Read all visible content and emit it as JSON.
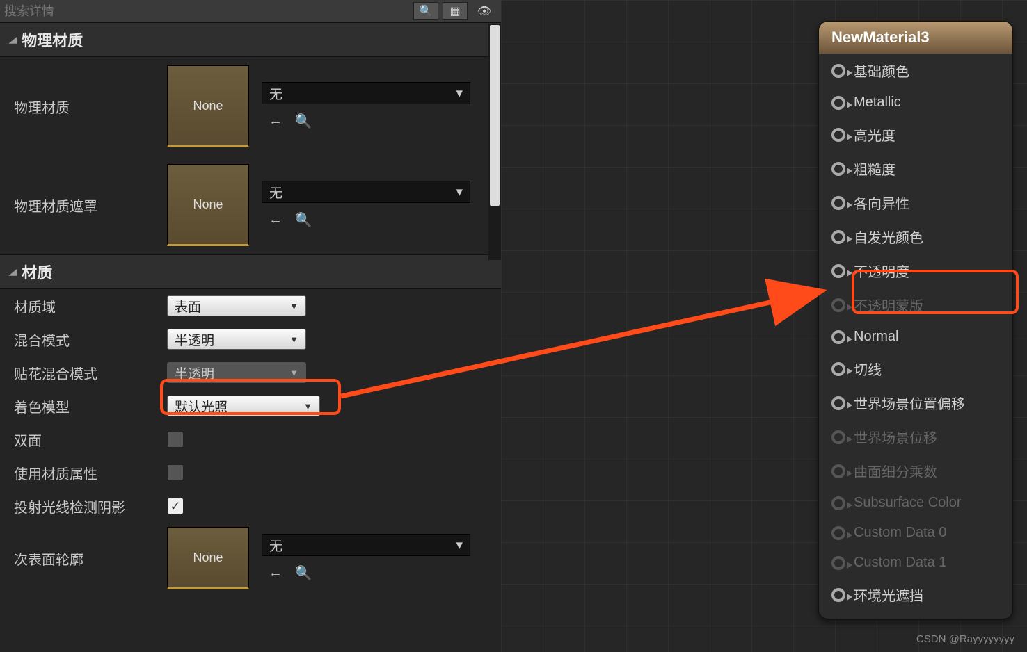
{
  "search": {
    "placeholder": "搜索详情"
  },
  "sections": {
    "physMat": "物理材质",
    "material": "材质"
  },
  "props": {
    "physMat": {
      "label": "物理材质",
      "thumb": "None",
      "dd": "无"
    },
    "physMatMask": {
      "label": "物理材质遮罩",
      "thumb": "None",
      "dd": "无"
    },
    "domain": {
      "label": "材质域",
      "value": "表面"
    },
    "blend": {
      "label": "混合模式",
      "value": "半透明"
    },
    "decalBlend": {
      "label": "贴花混合模式",
      "value": "半透明"
    },
    "shading": {
      "label": "着色模型",
      "value": "默认光照"
    },
    "twoSided": {
      "label": "双面"
    },
    "useMatAttrs": {
      "label": "使用材质属性"
    },
    "castShadow": {
      "label": "投射光线检测阴影"
    },
    "subsurface": {
      "label": "次表面轮廓",
      "thumb": "None",
      "dd": "无"
    }
  },
  "node": {
    "title": "NewMaterial3",
    "pins": [
      {
        "label": "基础颜色",
        "on": true
      },
      {
        "label": "Metallic",
        "on": true
      },
      {
        "label": "高光度",
        "on": true
      },
      {
        "label": "粗糙度",
        "on": true
      },
      {
        "label": "各向异性",
        "on": true
      },
      {
        "label": "自发光颜色",
        "on": true
      },
      {
        "label": "不透明度",
        "on": true
      },
      {
        "label": "不透明蒙版",
        "on": false
      },
      {
        "label": "Normal",
        "on": true
      },
      {
        "label": "切线",
        "on": true
      },
      {
        "label": "世界场景位置偏移",
        "on": true
      },
      {
        "label": "世界场景位移",
        "on": false
      },
      {
        "label": "曲面细分乘数",
        "on": false
      },
      {
        "label": "Subsurface Color",
        "on": false
      },
      {
        "label": "Custom Data 0",
        "on": false
      },
      {
        "label": "Custom Data 1",
        "on": false
      },
      {
        "label": "环境光遮挡",
        "on": true
      }
    ]
  },
  "watermark": "CSDN @Rayyyyyyyy"
}
